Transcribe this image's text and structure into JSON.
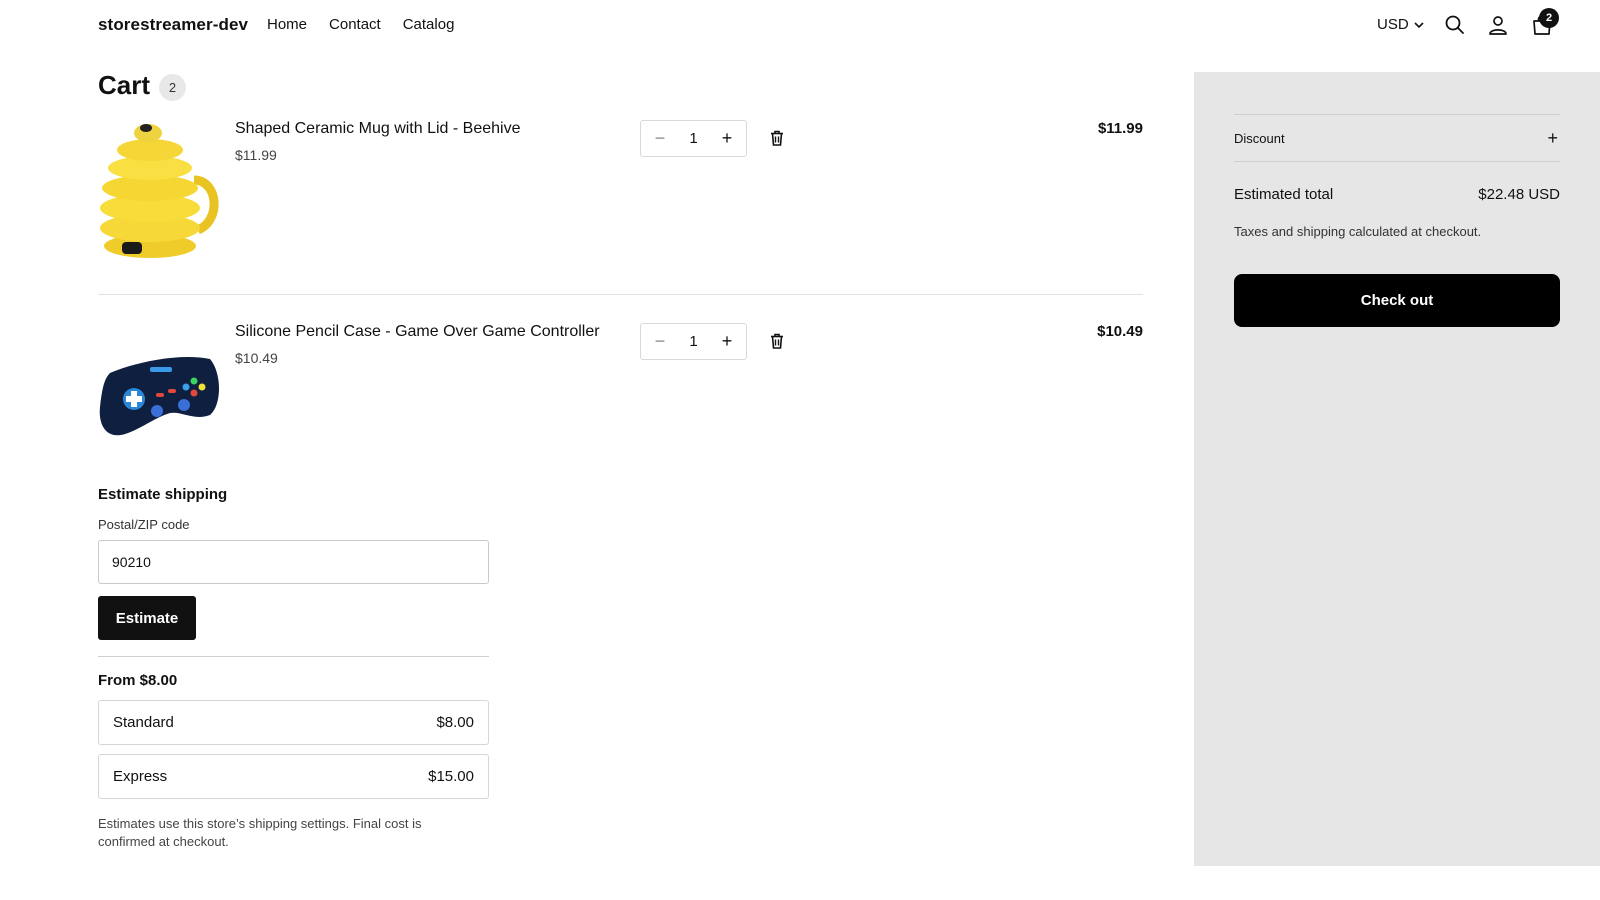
{
  "header": {
    "brand": "storestreamer-dev",
    "nav": [
      "Home",
      "Contact",
      "Catalog"
    ],
    "currency": "USD",
    "cart_count": "2"
  },
  "cart": {
    "title": "Cart",
    "count": "2",
    "items": [
      {
        "title": "Shaped Ceramic Mug with Lid - Beehive",
        "unit_price": "$11.99",
        "quantity": "1",
        "line_total": "$11.99",
        "image_icon": "beehive-mug-image"
      },
      {
        "title": "Silicone Pencil Case - Game Over Game Controller",
        "unit_price": "$10.49",
        "quantity": "1",
        "line_total": "$10.49",
        "image_icon": "game-controller-case-image"
      }
    ]
  },
  "shipping": {
    "title": "Estimate shipping",
    "zip_label": "Postal/ZIP code",
    "zip_value": "90210",
    "estimate_label": "Estimate",
    "from_label": "From $8.00",
    "rates": [
      {
        "name": "Standard",
        "price": "$8.00"
      },
      {
        "name": "Express",
        "price": "$15.00"
      }
    ],
    "note": "Estimates use this store’s shipping settings. Final cost is confirmed at checkout."
  },
  "summary": {
    "discount_label": "Discount",
    "estimated_total_label": "Estimated total",
    "estimated_total_value": "$22.48 USD",
    "tax_note": "Taxes and shipping calculated at checkout.",
    "checkout_label": "Check out"
  },
  "colors": {
    "accent": "#111111",
    "summary_bg": "#e6e6e6"
  }
}
